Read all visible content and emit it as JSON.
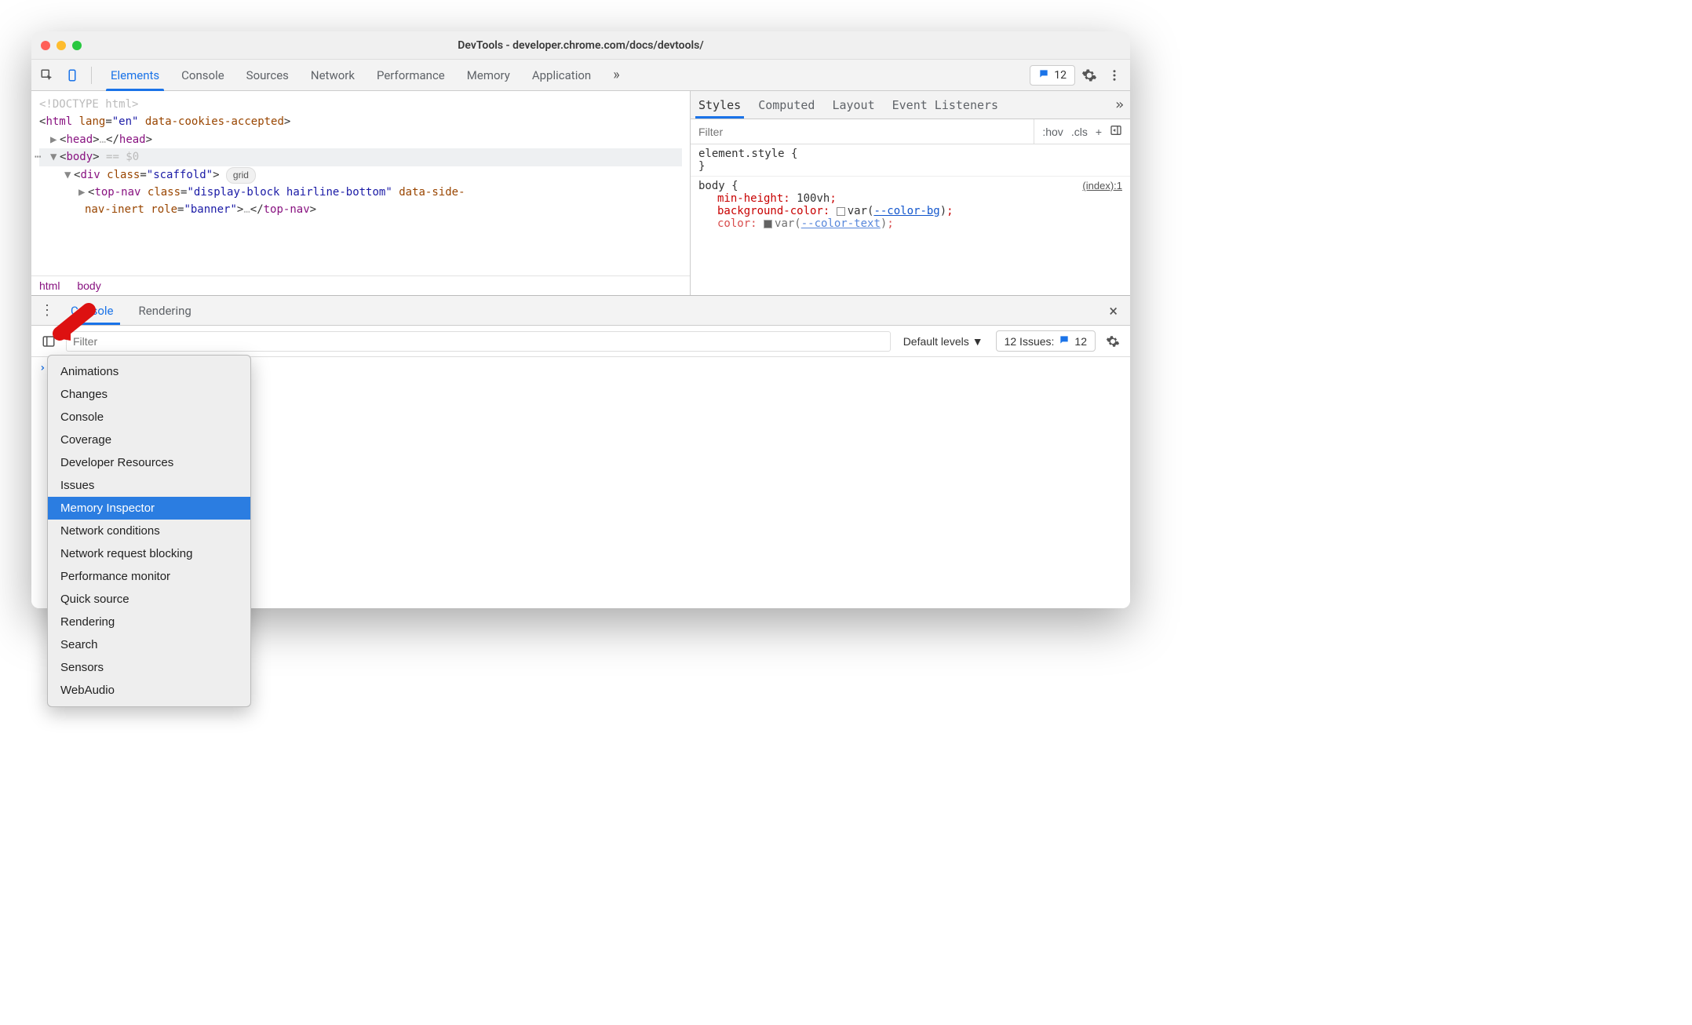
{
  "window": {
    "title": "DevTools - developer.chrome.com/docs/devtools/"
  },
  "mainTabs": {
    "items": [
      "Elements",
      "Console",
      "Sources",
      "Network",
      "Performance",
      "Memory",
      "Application"
    ],
    "activeIndex": 0,
    "overflow": "»",
    "issueBadge": "12"
  },
  "dom": {
    "l0": "<!DOCTYPE html>",
    "l1": {
      "tag": "html",
      "attrs": "lang=\"en\" data-cookies-accepted"
    },
    "l2": {
      "open": "<head>",
      "mid": "…",
      "close": "</head>"
    },
    "l3": {
      "tag": "body",
      "suffix": " == $0"
    },
    "l4": {
      "tag": "div",
      "attrs": "class=\"scaffold\"",
      "pill": "grid"
    },
    "l5": "<top-nav class=\"display-block hairline-bottom\" data-side-nav-inert role=\"banner\">…</top-nav>",
    "breadcrumb": {
      "root": "html",
      "leaf": "body"
    }
  },
  "stylesTabs": {
    "items": [
      "Styles",
      "Computed",
      "Layout",
      "Event Listeners"
    ],
    "activeIndex": 0,
    "overflow": "»"
  },
  "stylesFilter": {
    "placeholder": "Filter",
    "hov": ":hov",
    "cls": ".cls",
    "plus": "+"
  },
  "rules": {
    "r1": {
      "sel": "element.style {",
      "close": "}"
    },
    "r2": {
      "sel": "body {",
      "link": "(index):1",
      "p1": {
        "n": "min-height",
        "v": "100vh"
      },
      "p2": {
        "n": "background-color",
        "var": "--color-bg"
      },
      "p3": {
        "n": "color",
        "var": "--color-text"
      }
    }
  },
  "drawer": {
    "tabs": [
      "Console",
      "Rendering"
    ],
    "activeIndex": 0,
    "filterPlaceholder": "Filter",
    "levels": "Default levels",
    "issuesLabel": "12 Issues:",
    "issuesCount": "12"
  },
  "dropdown": {
    "items": [
      "Animations",
      "Changes",
      "Console",
      "Coverage",
      "Developer Resources",
      "Issues",
      "Memory Inspector",
      "Network conditions",
      "Network request blocking",
      "Performance monitor",
      "Quick source",
      "Rendering",
      "Search",
      "Sensors",
      "WebAudio"
    ],
    "highlightIndex": 6
  }
}
